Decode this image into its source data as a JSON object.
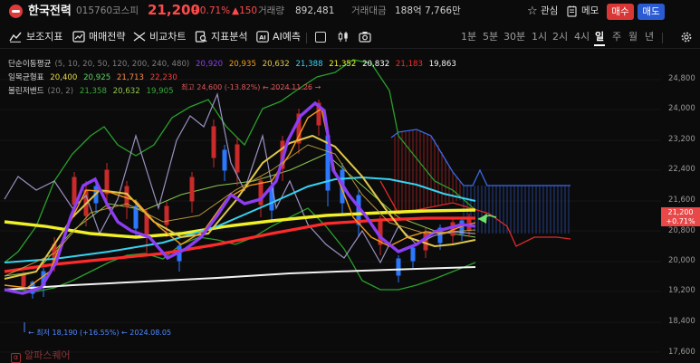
{
  "header": {
    "name": "한국전력",
    "code": "015760",
    "market": "코스피",
    "price": "21,200",
    "change_pct": "+0.71%",
    "change_amt": "▲150",
    "volume_label": "거래량",
    "volume": "892,481",
    "amount_label": "거래대금",
    "amount": "188억 7,766만",
    "favorite_label": "관심",
    "memo_label": "메모",
    "buy_label": "매수",
    "sell_label": "매도"
  },
  "toolbar": {
    "items": [
      "보조지표",
      "매매전략",
      "비교차트",
      "지표분석",
      "AI예측"
    ],
    "timeframes": [
      "1분",
      "5분",
      "30분",
      "1시",
      "2시",
      "4시",
      "일",
      "주",
      "월",
      "년"
    ],
    "active_timeframe": "일"
  },
  "legend": {
    "sma": {
      "label": "단순이동평균",
      "params": "(5, 10, 20, 50, 120, 200, 240, 480)",
      "values": [
        {
          "v": "20,920",
          "color": "#8d3df2"
        },
        {
          "v": "20,935",
          "color": "#f29c1a"
        },
        {
          "v": "20,632",
          "color": "#e0c84a"
        },
        {
          "v": "21,388",
          "color": "#37d3f0"
        },
        {
          "v": "21,352",
          "color": "#f0f028"
        },
        {
          "v": "20,832",
          "color": "#ffffff"
        },
        {
          "v": "21,183",
          "color": "#ff2a2a"
        },
        {
          "v": "19,863",
          "color": "#f2f2f2"
        }
      ]
    },
    "ichimoku": {
      "label": "일목균형표",
      "values": [
        {
          "v": "20,400",
          "color": "#e8d84a"
        },
        {
          "v": "20,925",
          "color": "#5fd05f"
        },
        {
          "v": "21,713",
          "color": "#ff8a4a"
        },
        {
          "v": "22,230",
          "color": "#ff3a3a"
        }
      ]
    },
    "bollinger": {
      "label": "볼린저밴드",
      "params": "(20, 2)",
      "values": [
        {
          "v": "21,358",
          "color": "#3aa83a"
        },
        {
          "v": "20,632",
          "color": "#8cc84a"
        },
        {
          "v": "19,905",
          "color": "#3aa83a"
        }
      ]
    }
  },
  "y_axis": [
    "24,800",
    "24,000",
    "23,200",
    "22,400",
    "21,600",
    "20,800",
    "20,000",
    "19,200",
    "18,400",
    "17,600"
  ],
  "current_badge": {
    "price": "21,200",
    "pct": "+0.71%"
  },
  "annotations": {
    "high": "최고 24,600 (-13.82%) ← 2024.11.26 →",
    "low": "← 최저 18,190 (+16.55%) ← 2024.08.05"
  },
  "watermark": "알파스퀘어",
  "colors": {
    "up": "#ff4a4a",
    "down": "#2b78ff",
    "accent": "#e84848"
  }
}
